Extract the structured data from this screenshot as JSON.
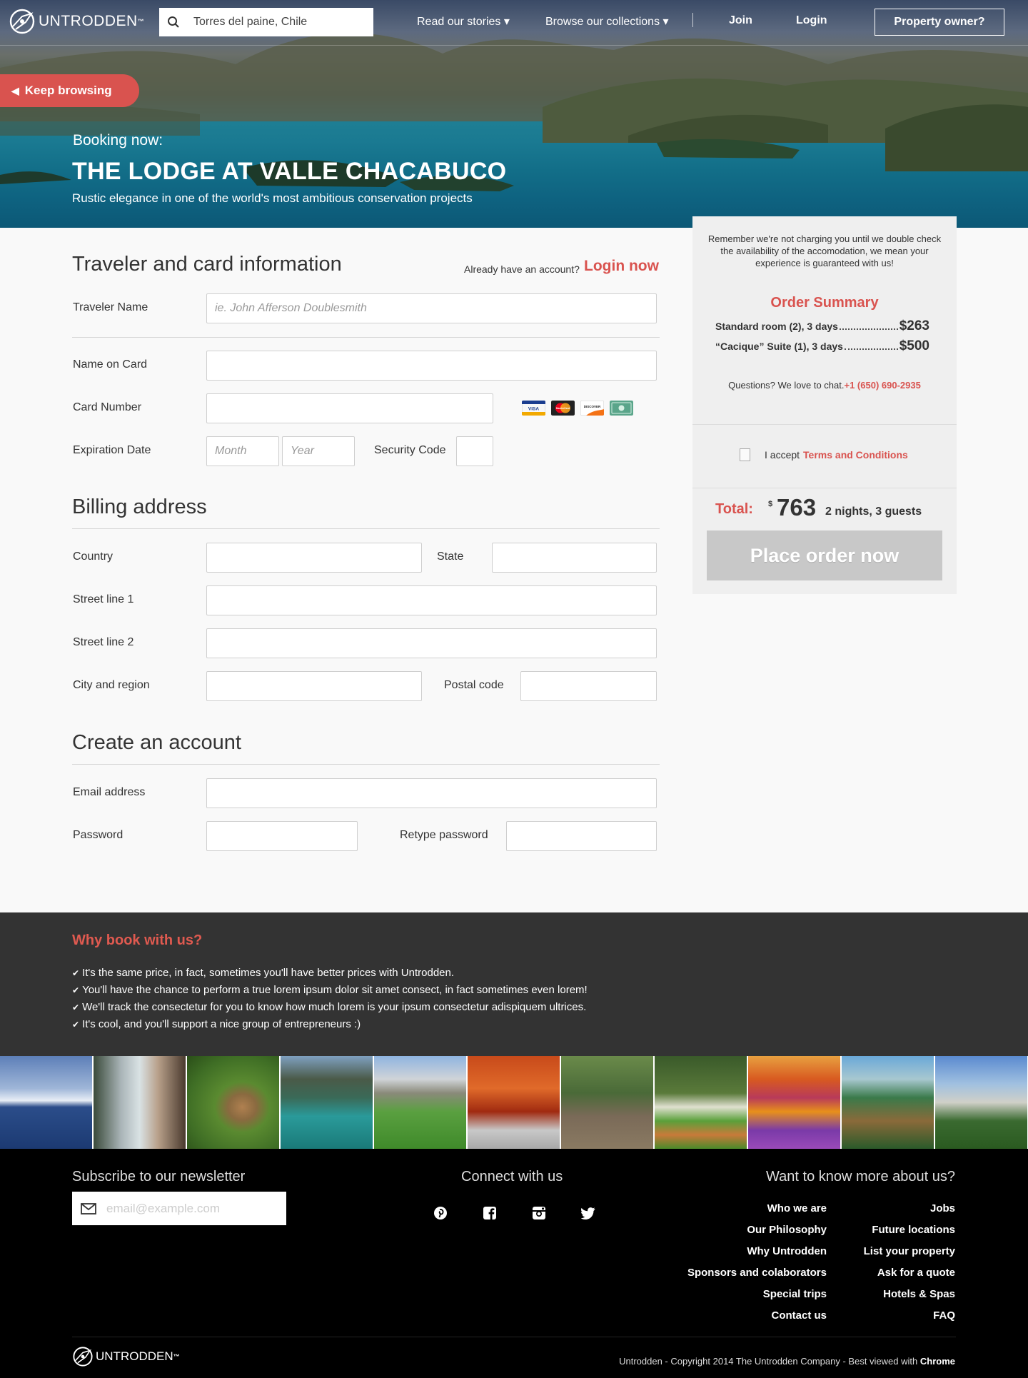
{
  "brand": {
    "name": "UNTRODDEN",
    "tm": "™"
  },
  "header": {
    "search_value": "Torres del paine, Chile",
    "nav": {
      "stories": "Read our stories ▾",
      "collections": "Browse our collections ▾",
      "join": "Join",
      "login": "Login",
      "owner": "Property owner?"
    },
    "keep_browsing": "Keep browsing"
  },
  "hero": {
    "booking_now": "Booking now:",
    "title": "THE LODGE AT VALLE CHACABUCO",
    "subtitle": "Rustic elegance in one of the world's most ambitious conservation projects"
  },
  "traveler": {
    "heading": "Traveler and card information",
    "already": "Already have an account?",
    "login_now": "Login now",
    "name_label": "Traveler Name",
    "name_placeholder": "ie. John Afferson Doublesmith",
    "card_name_label": "Name on Card",
    "card_number_label": "Card Number",
    "exp_label": "Expiration Date",
    "month_placeholder": "Month",
    "year_placeholder": "Year",
    "security_label": "Security Code",
    "cards": [
      "VISA",
      "MasterCard",
      "DISCOVER",
      "Other"
    ]
  },
  "billing": {
    "heading": "Billing address",
    "country": "Country",
    "state": "State",
    "street1": "Street line 1",
    "street2": "Street line 2",
    "city": "City and region",
    "postal": "Postal code"
  },
  "account": {
    "heading": "Create an account",
    "email": "Email address",
    "password": "Password",
    "retype": "Retype password"
  },
  "sidebar": {
    "note": "Remember we're not charging you until we double check the availability of the accomodation, we mean your experience is guaranteed with us!",
    "order_title": "Order Summary",
    "items": [
      {
        "label": "Standard room (2), 3 days",
        "price": "$263"
      },
      {
        "label": "“Cacique” Suite (1), 3 days",
        "price": "$500"
      }
    ],
    "chat_text": "Questions? We love to chat.",
    "phone": "+1 (650) 690-2935",
    "accept_text": "I accept",
    "terms": "Terms and Conditions",
    "total_label": "Total:",
    "currency": "$",
    "total": "763",
    "total_meta": "2 nights, 3 guests",
    "place_order": "Place order now"
  },
  "why": {
    "title": "Why book with us?",
    "items": [
      "It's the same price, in fact, sometimes you'll have better prices with Untrodden.",
      "You'll have the chance to perform a true lorem ipsum dolor sit amet consect, in fact sometimes even lorem!",
      "We'll track the consectetur for you to know how much lorem is your ipsum consectetur adispiquem ultrices.",
      "It's cool, and you'll support a nice group of entrepreneurs :)"
    ]
  },
  "footer": {
    "newsletter_title": "Subscribe to our newsletter",
    "email_placeholder": "email@example.com",
    "connect_title": "Connect with us",
    "social": [
      "pinterest",
      "facebook",
      "instagram",
      "twitter"
    ],
    "about_title": "Want to know more about us?",
    "links_col1": [
      "Who we are",
      "Our Philosophy",
      "Why Untrodden",
      "Sponsors and colaborators",
      "Special trips",
      "Contact us"
    ],
    "links_col2": [
      "Jobs",
      "Future locations",
      "List your property",
      "Ask for a quote",
      "Hotels & Spas",
      "FAQ"
    ],
    "copyright": "Untrodden - Copyright 2014 The Untrodden Company - Best viewed with",
    "browser": "Chrome"
  },
  "colors": {
    "accent": "#d9534f",
    "dark": "#333333",
    "footer": "#000000"
  }
}
